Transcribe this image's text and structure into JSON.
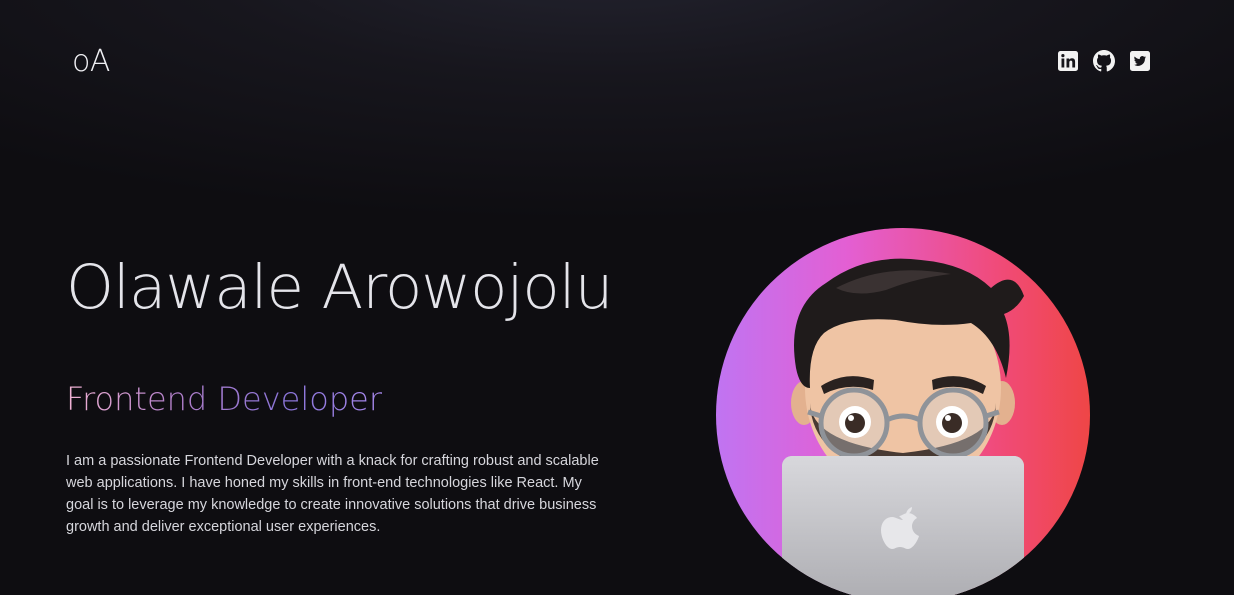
{
  "header": {
    "logo": "oA",
    "socials": [
      {
        "icon": "linkedin-icon"
      },
      {
        "icon": "github-icon"
      },
      {
        "icon": "twitter-icon"
      }
    ]
  },
  "hero": {
    "name": "Olawale Arowojolu",
    "role": "Frontend Developer",
    "bio": "I am a passionate Frontend Developer with a knack for crafting robust and scalable web applications. I have honed my skills in front-end technologies like React. My goal is to leverage my knowledge to create innovative solutions that drive business growth and deliver exceptional user experiences."
  },
  "colors": {
    "background": "#0f0e12",
    "text": "#e4e4ea",
    "role_gradient": [
      "#f1b3d4",
      "#8a74d8"
    ],
    "avatar_gradient": [
      "#c074f2",
      "#ef4646"
    ]
  },
  "avatar": {
    "icon": "memoji-developer-avatar"
  }
}
